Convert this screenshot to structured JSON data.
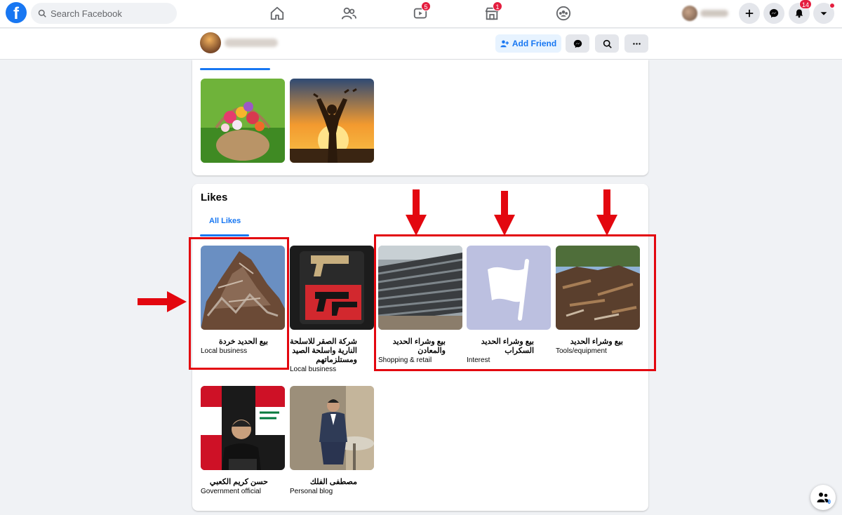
{
  "topbar": {
    "logo_glyph": "f",
    "search_placeholder": "Search Facebook",
    "nav": [
      {
        "name": "home-icon",
        "badge": ""
      },
      {
        "name": "friends-icon",
        "badge": ""
      },
      {
        "name": "watch-icon",
        "badge": "5"
      },
      {
        "name": "marketplace-icon",
        "badge": "1"
      },
      {
        "name": "groups-icon",
        "badge": ""
      }
    ],
    "notifications_badge": "14"
  },
  "profile_header": {
    "add_friend_label": "Add Friend"
  },
  "likes": {
    "title": "Likes",
    "tab_all": "All Likes",
    "items": [
      {
        "name": "بيع الحديد خردة",
        "category": "Local business"
      },
      {
        "name": "شركة الصقر للاسلحة النارية واسلحة الصيد ومستلزماتهم",
        "category": "Local business"
      },
      {
        "name": "بيع وشراء الحديد والمعادن",
        "category": "Shopping & retail"
      },
      {
        "name": "بيع وشراء الحديد السكراب",
        "category": "Interest"
      },
      {
        "name": "بيع وشراء الحديد",
        "category": "Tools/equipment"
      },
      {
        "name": "حسن كريم الكعبي",
        "category": "Government official"
      },
      {
        "name": "مصطفى الفلك",
        "category": "Personal blog"
      }
    ]
  },
  "colors": {
    "brand": "#1877f2",
    "annotation_red": "#e3070f",
    "badge_red": "#e41e3f"
  },
  "chat_fab": {
    "count": "0"
  }
}
